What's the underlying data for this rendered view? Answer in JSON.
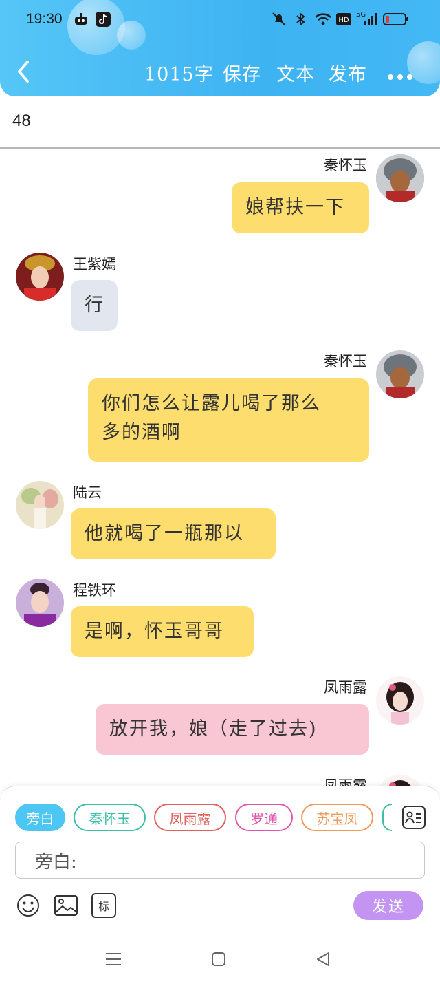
{
  "status_bar": {
    "time": "19:30",
    "network": "5G"
  },
  "header": {
    "word_count": "1015字",
    "save_label": "保存",
    "text_label": "文本",
    "publish_label": "发布",
    "more_label": "•••"
  },
  "counter": "48",
  "messages": [
    {
      "side": "right",
      "name": "秦怀玉",
      "text": "娘帮扶一下",
      "color": "#fcdd6e"
    },
    {
      "side": "left",
      "name": "王紫嫣",
      "text": "行",
      "color": "#e2e6ee"
    },
    {
      "side": "right",
      "name": "秦怀玉",
      "text_line1": "你们怎么让露儿喝了那么",
      "text_line2": "多的酒啊",
      "color": "#fcdd6e"
    },
    {
      "side": "left",
      "name": "陆云",
      "text": "他就喝了一瓶那以",
      "color": "#fcdd6e"
    },
    {
      "side": "left",
      "name": "程铁环",
      "text": "是啊，怀玉哥哥",
      "color": "#fcdd6e"
    },
    {
      "side": "right",
      "name": "凤雨露",
      "text": "放开我，娘（走了过去)",
      "color": "#f8c7d3"
    },
    {
      "side": "right",
      "name": "凤雨露"
    }
  ],
  "composer": {
    "roles": [
      {
        "label": "旁白",
        "color": "#4cc6f2",
        "selected": true
      },
      {
        "label": "秦怀玉",
        "color": "#3dbfa7"
      },
      {
        "label": "凤雨露",
        "color": "#e0605e"
      },
      {
        "label": "罗通",
        "color": "#e055a8"
      },
      {
        "label": "苏宝凤",
        "color": "#ee9a5a"
      }
    ],
    "input_value": "旁白:",
    "tool_mark_label": "标",
    "send_label": "发送"
  },
  "icons": [
    "back-icon",
    "more-icon",
    "contacts-icon",
    "emoji-icon",
    "image-icon",
    "menu-icon",
    "home-icon",
    "back-triangle-icon"
  ]
}
